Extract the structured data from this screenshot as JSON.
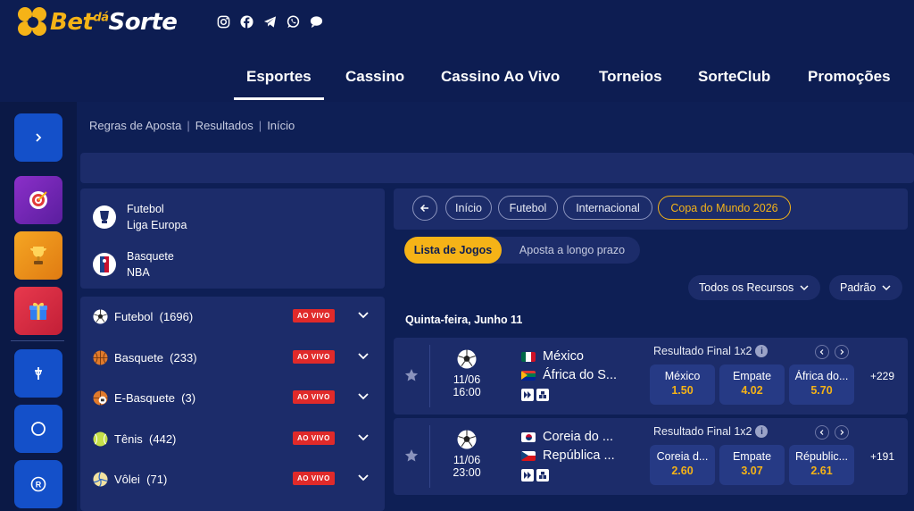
{
  "brand": {
    "bet": "Bet",
    "da": "dá",
    "sorte": "Sorte"
  },
  "socials": [
    "instagram-icon",
    "facebook-icon",
    "telegram-icon",
    "whatsapp-icon",
    "chat-icon"
  ],
  "nav": {
    "items": [
      "Esportes",
      "Cassino",
      "Cassino Ao Vivo",
      "Torneios",
      "SorteClub",
      "Promoções"
    ],
    "active": "Esportes"
  },
  "breadcrumb": {
    "items": [
      "Regras de Aposta",
      "Resultados",
      "Início"
    ],
    "separator": "|"
  },
  "favorites": [
    {
      "sport": "Futebol",
      "league": "Liga Europa"
    },
    {
      "sport": "Basquete",
      "league": "NBA"
    }
  ],
  "sports": [
    {
      "name": "Futebol",
      "count": "(1696)",
      "badge": "AO VIVO"
    },
    {
      "name": "Basquete",
      "count": "(233)",
      "badge": "AO VIVO"
    },
    {
      "name": "E-Basquete",
      "count": "(3)",
      "badge": "AO VIVO"
    },
    {
      "name": "Tênis",
      "count": "(442)",
      "badge": "AO VIVO"
    },
    {
      "name": "Vôlei",
      "count": "(71)",
      "badge": "AO VIVO"
    }
  ],
  "filters": [
    "Início",
    "Futebol",
    "Internacional",
    "Copa do Mundo 2026"
  ],
  "tabs": {
    "active": "Lista de Jogos",
    "inactive": "Aposta a longo prazo"
  },
  "dropdowns": {
    "resources": "Todos os Recursos",
    "sort": "Padrão"
  },
  "date_heading": "Quinta-feira,  Junho 11",
  "matches": [
    {
      "date": "11/06",
      "time": "16:00",
      "home": "México",
      "away": "África do S...",
      "market": "Resultado Final 1x2",
      "odds": [
        {
          "label": "México",
          "value": "1.50"
        },
        {
          "label": "Empate",
          "value": "4.02"
        },
        {
          "label": "África do...",
          "value": "5.70"
        }
      ],
      "more": "+229"
    },
    {
      "date": "11/06",
      "time": "23:00",
      "home": "Coreia do ...",
      "away": "República ...",
      "market": "Resultado Final 1x2",
      "odds": [
        {
          "label": "Coreia d...",
          "value": "2.60"
        },
        {
          "label": "Empate",
          "value": "3.07"
        },
        {
          "label": "Républic...",
          "value": "2.61"
        }
      ],
      "more": "+191"
    }
  ],
  "colors": {
    "background": "#0e1f55",
    "panel": "#1c2c6a",
    "accent": "#f5b317",
    "live": "#e02a2a"
  }
}
